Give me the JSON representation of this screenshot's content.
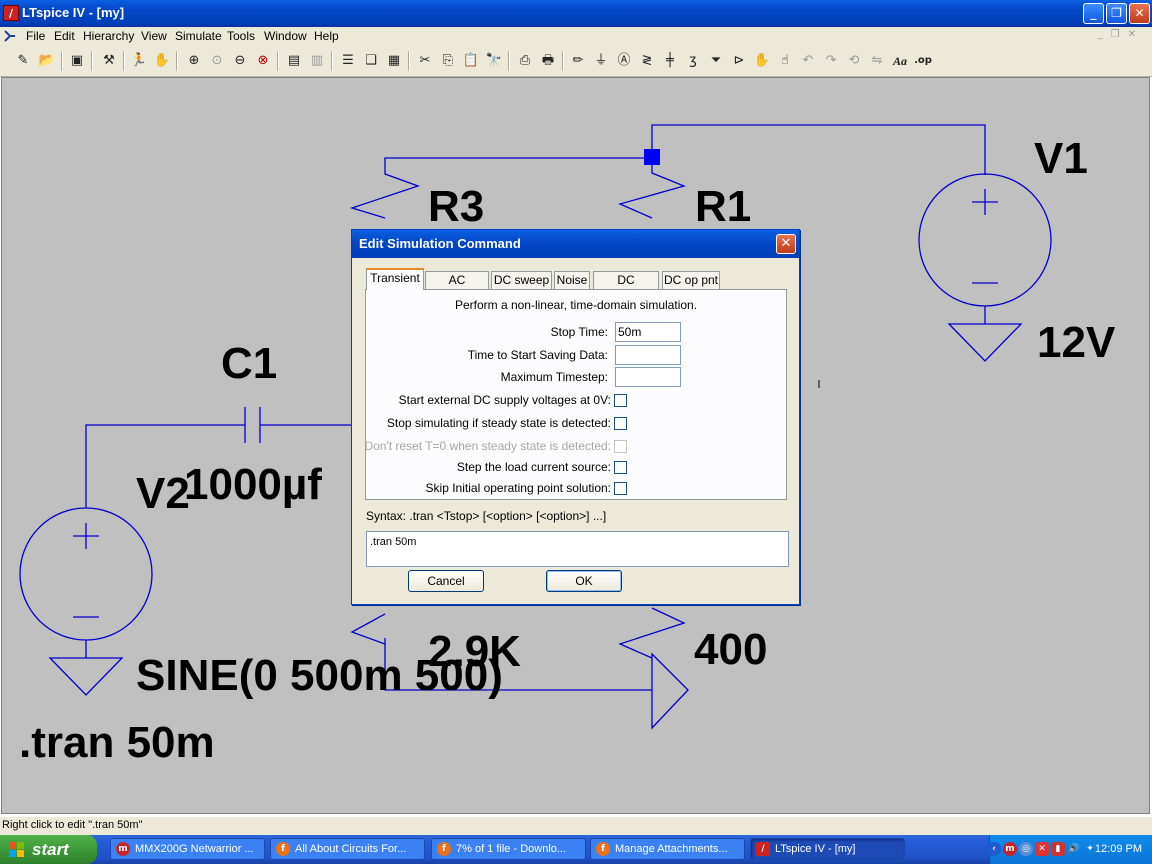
{
  "window": {
    "title": "LTspice IV - [my]",
    "min_glyph": "_",
    "restore_glyph": "❐",
    "close_glyph": "✕"
  },
  "menu": [
    "File",
    "Edit",
    "Hierarchy",
    "View",
    "Simulate",
    "Tools",
    "Window",
    "Help"
  ],
  "toolbar_icons": [
    "new-schematic-icon",
    "open-icon",
    "save-icon",
    "control-panel-icon",
    "run-icon",
    "halt-icon",
    "zoom-in-icon",
    "zoom-pan-icon",
    "zoom-out-icon",
    "zoom-fit-icon",
    "autorange-icon",
    "delete-trace-icon",
    "tile-horizontal-icon",
    "cascade-icon",
    "tile-vertical-icon",
    "cut-icon",
    "copy-icon",
    "paste-icon",
    "find-icon",
    "print-setup-icon",
    "print-icon",
    "draw-wire-icon",
    "ground-icon",
    "label-net-icon",
    "resistor-icon",
    "capacitor-icon",
    "inductor-icon",
    "diode-icon",
    "component-icon",
    "move-icon",
    "drag-icon",
    "undo-icon",
    "redo-icon",
    "rotate-icon",
    "mirror-icon",
    "text-icon",
    "spice-directive-icon"
  ],
  "schematic": {
    "labels": {
      "r3": "R3",
      "r1": "R1",
      "v1": "V1",
      "v1_value": "12V",
      "c1": "C1",
      "c1_value": "1000µf",
      "v2": "V2",
      "v2_value": "SINE(0 500m 500)",
      "r3_value": "2.9K",
      "r1_value": "400",
      "directive": ".tran 50m"
    },
    "colors": {
      "wire": "#0000cc",
      "background": "#c0c0c0",
      "junction": "#0000ff"
    }
  },
  "dialog": {
    "title": "Edit Simulation Command",
    "tabs": [
      "Transient",
      "AC Analysis",
      "DC sweep",
      "Noise",
      "DC Transfer",
      "DC op pnt"
    ],
    "active_tab": "Transient",
    "description": "Perform a non-linear, time-domain simulation.",
    "fields": [
      {
        "label": "Stop Time:",
        "value": "50m"
      },
      {
        "label": "Time to Start Saving Data:",
        "value": ""
      },
      {
        "label": "Maximum Timestep:",
        "value": ""
      }
    ],
    "checkboxes": [
      {
        "label": "Start external DC supply voltages at 0V:",
        "checked": false,
        "enabled": true
      },
      {
        "label": "Stop simulating if steady state is detected:",
        "checked": false,
        "enabled": true
      },
      {
        "label": "Don't reset T=0 when steady state is detected:",
        "checked": false,
        "enabled": false
      },
      {
        "label": "Step the load current source:",
        "checked": false,
        "enabled": true
      },
      {
        "label": "Skip Initial operating point solution:",
        "checked": false,
        "enabled": true
      }
    ],
    "syntax": "Syntax:  .tran <Tstop> [<option> [<option>] ...]",
    "command": ".tran 50m",
    "cancel_label": "Cancel",
    "ok_label": "OK"
  },
  "status": "Right click to edit \".tran 50m\"",
  "taskbar": {
    "start_label": "start",
    "tasks": [
      {
        "label": "MMX200G Netwarrior ...",
        "icon": "m",
        "color": "#c4262e"
      },
      {
        "label": "All About Circuits For...",
        "icon": "f",
        "color": "#e8721c"
      },
      {
        "label": "7% of 1 file - Downlo...",
        "icon": "f",
        "color": "#e8721c"
      },
      {
        "label": "Manage Attachments...",
        "icon": "f",
        "color": "#e8721c"
      },
      {
        "label": "LTspice IV - [my]",
        "icon": "/",
        "color": "#c22"
      }
    ],
    "clock": "12:09 PM"
  }
}
